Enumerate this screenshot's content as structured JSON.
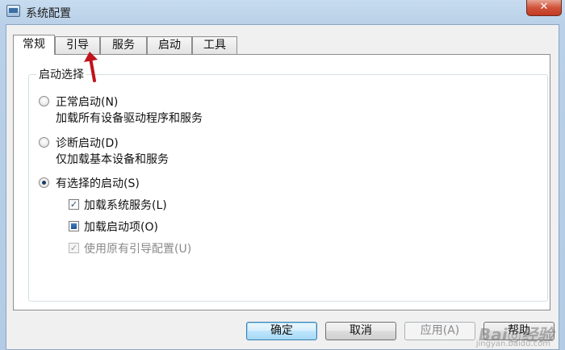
{
  "window": {
    "title": "系统配置",
    "close_glyph": "✕"
  },
  "tabs": [
    {
      "label": "常规",
      "active": true
    },
    {
      "label": "引导",
      "active": false
    },
    {
      "label": "服务",
      "active": false
    },
    {
      "label": "启动",
      "active": false
    },
    {
      "label": "工具",
      "active": false
    }
  ],
  "startup_group": {
    "title": "启动选择",
    "normal": {
      "label": "正常启动(N)",
      "desc": "加载所有设备驱动程序和服务",
      "checked": false
    },
    "diagnostic": {
      "label": "诊断启动(D)",
      "desc": "仅加载基本设备和服务",
      "checked": false
    },
    "selective": {
      "label": "有选择的启动(S)",
      "checked": true
    },
    "load_system_services": {
      "label": "加载系统服务(L)",
      "state": "checked",
      "mark": "✓"
    },
    "load_startup_items": {
      "label": "加载启动项(O)",
      "state": "indeterminate"
    },
    "use_original_boot": {
      "label": "使用原有引导配置(U)",
      "state": "checked-disabled",
      "mark": "✓"
    }
  },
  "buttons": {
    "ok": "确定",
    "cancel": "取消",
    "apply": "应用(A)",
    "help": "帮助"
  },
  "annotation": {
    "arrow_color": "#c0141c"
  },
  "watermark": {
    "brand": "Bai◎经验",
    "sub": "jingyan.baidu.com"
  }
}
